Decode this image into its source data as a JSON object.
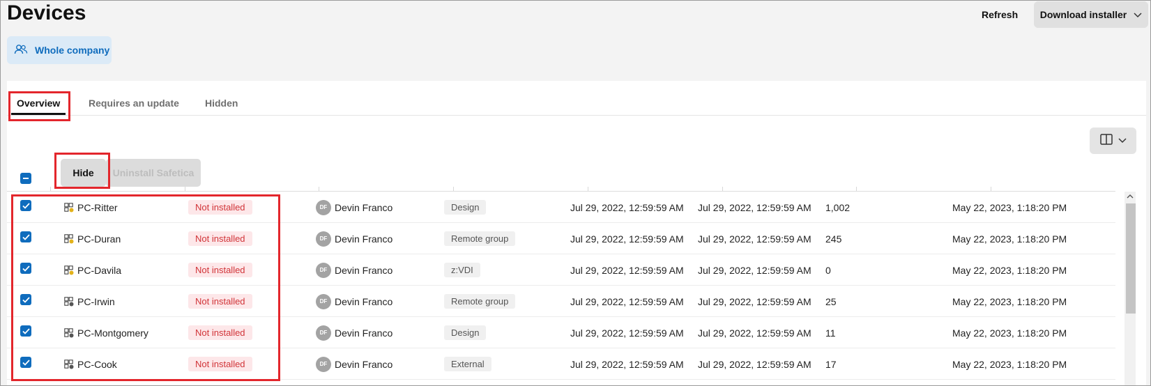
{
  "page": {
    "title": "Devices"
  },
  "header": {
    "refresh_label": "Refresh",
    "download_label": "Download installer"
  },
  "scope": {
    "label": "Whole company"
  },
  "tabs": [
    {
      "label": "Overview",
      "active": true
    },
    {
      "label": "Requires an update",
      "active": false
    },
    {
      "label": "Hidden",
      "active": false
    }
  ],
  "toolbar": {
    "hide_label": "Hide",
    "uninstall_label": "Uninstall Safetica"
  },
  "rows": [
    {
      "name": "PC-Ritter",
      "status": "Not installed",
      "user_initials": "DF",
      "user": "Devin Franco",
      "group": "Design",
      "date1": "Jul 29, 2022, 12:59:59 AM",
      "date2": "Jul 29, 2022, 12:59:59 AM",
      "count": "1,002",
      "date3": "May 22, 2023, 1:18:20 PM",
      "dot_color": "#e3b21a"
    },
    {
      "name": "PC-Duran",
      "status": "Not installed",
      "user_initials": "DF",
      "user": "Devin Franco",
      "group": "Remote group",
      "date1": "Jul 29, 2022, 12:59:59 AM",
      "date2": "Jul 29, 2022, 12:59:59 AM",
      "count": "245",
      "date3": "May 22, 2023, 1:18:20 PM",
      "dot_color": "#e3b21a"
    },
    {
      "name": "PC-Davila",
      "status": "Not installed",
      "user_initials": "DF",
      "user": "Devin Franco",
      "group": "z:VDI",
      "date1": "Jul 29, 2022, 12:59:59 AM",
      "date2": "Jul 29, 2022, 12:59:59 AM",
      "count": "0",
      "date3": "May 22, 2023, 1:18:20 PM",
      "dot_color": "#e3b21a"
    },
    {
      "name": "PC-Irwin",
      "status": "Not installed",
      "user_initials": "DF",
      "user": "Devin Franco",
      "group": "Remote group",
      "date1": "Jul 29, 2022, 12:59:59 AM",
      "date2": "Jul 29, 2022, 12:59:59 AM",
      "count": "25",
      "date3": "May 22, 2023, 1:18:20 PM",
      "dot_color": "#555555"
    },
    {
      "name": "PC-Montgomery",
      "status": "Not installed",
      "user_initials": "DF",
      "user": "Devin Franco",
      "group": "Design",
      "date1": "Jul 29, 2022, 12:59:59 AM",
      "date2": "Jul 29, 2022, 12:59:59 AM",
      "count": "11",
      "date3": "May 22, 2023, 1:18:20 PM",
      "dot_color": "#555555"
    },
    {
      "name": "PC-Cook",
      "status": "Not installed",
      "user_initials": "DF",
      "user": "Devin Franco",
      "group": "External",
      "date1": "Jul 29, 2022, 12:59:59 AM",
      "date2": "Jul 29, 2022, 12:59:59 AM",
      "count": "17",
      "date3": "May 22, 2023, 1:18:20 PM",
      "dot_color": "#555555"
    }
  ],
  "colors": {
    "accent": "#0f6cbd",
    "status_error": "#d13438",
    "highlight": "#e3262c"
  }
}
